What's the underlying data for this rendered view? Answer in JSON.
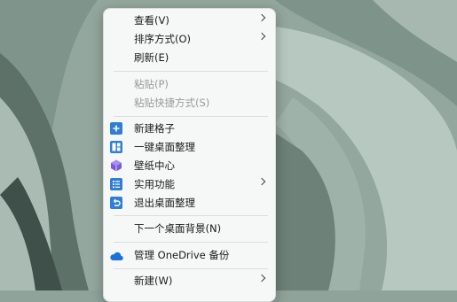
{
  "menu": {
    "view": "查看(V)",
    "sort_by": "排序方式(O)",
    "refresh": "刷新(E)",
    "paste": "粘贴(P)",
    "paste_shortcut": "粘贴快捷方式(S)",
    "new_fence": "新建格子",
    "one_click_tidy": "一键桌面整理",
    "wallpaper_center": "壁纸中心",
    "utilities": "实用功能",
    "exit_tidy": "退出桌面整理",
    "next_background": "下一个桌面背景(N)",
    "manage_onedrive": "管理 OneDrive 备份",
    "new": "新建(W)"
  },
  "icons": {
    "new_fence": "plus-square-icon",
    "one_click_tidy": "layout-grid-icon",
    "wallpaper_center": "cube-icon",
    "utilities": "list-icon",
    "exit_tidy": "undo-square-icon",
    "manage_onedrive": "onedrive-cloud-icon"
  },
  "colors": {
    "accent": "#2f7fd6",
    "purple": "#7a5ad8",
    "menu_bg": "#f9fafa",
    "disabled": "#9a9a9a"
  }
}
